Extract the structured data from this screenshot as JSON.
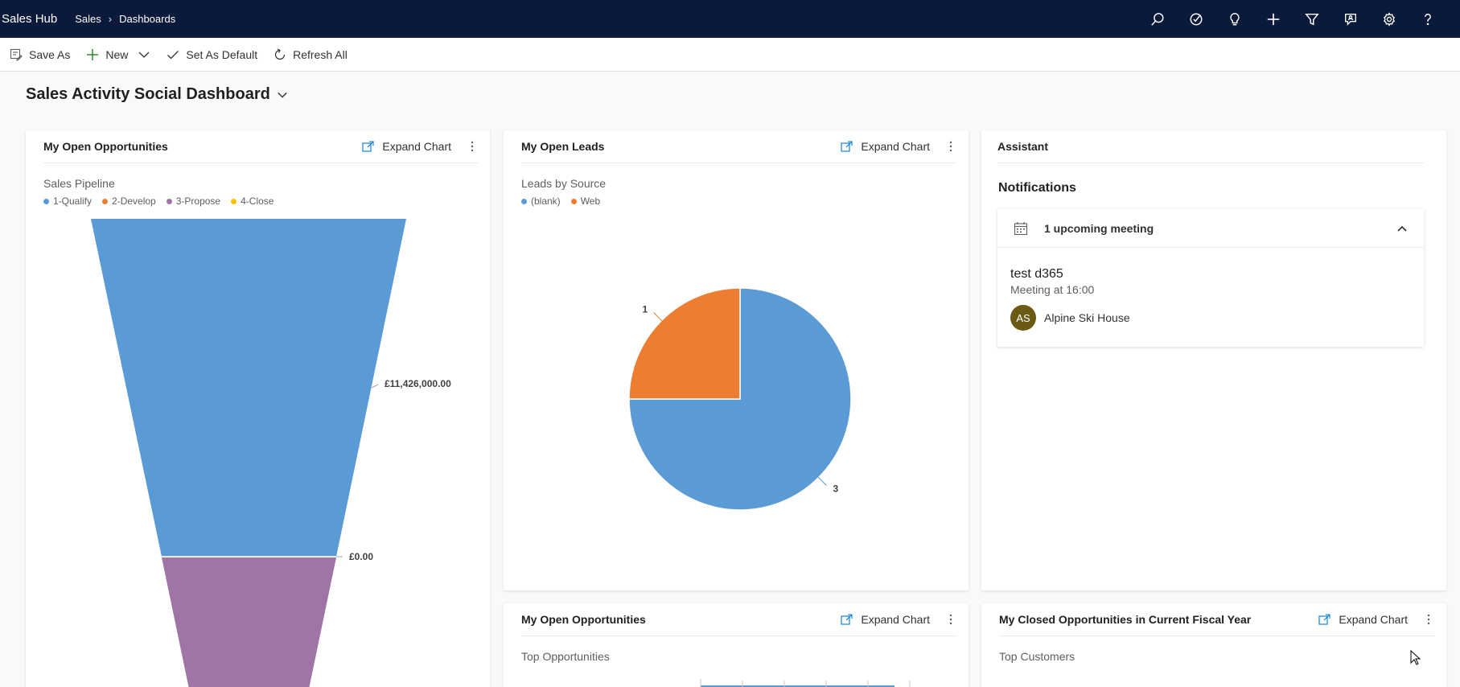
{
  "nav": {
    "app_name": "Sales Hub",
    "breadcrumb": [
      "Sales",
      "Dashboards"
    ],
    "icons": [
      "search-icon",
      "task-check-icon",
      "lightbulb-icon",
      "plus-icon",
      "filter-icon",
      "assistant-icon",
      "settings-icon",
      "help-icon"
    ]
  },
  "commands": {
    "save_as": "Save As",
    "new": "New",
    "set_default": "Set As Default",
    "refresh_all": "Refresh All"
  },
  "dashboard": {
    "title": "Sales Activity Social Dashboard"
  },
  "expand_label": "Expand Chart",
  "cards": {
    "opps": {
      "title": "My Open Opportunities",
      "chart_title": "Sales Pipeline",
      "legend": [
        {
          "label": "1-Qualify",
          "color": "#5b9bd5"
        },
        {
          "label": "2-Develop",
          "color": "#ed7d31"
        },
        {
          "label": "3-Propose",
          "color": "#a074a6"
        },
        {
          "label": "4-Close",
          "color": "#ffc000"
        }
      ]
    },
    "leads": {
      "title": "My Open Leads",
      "chart_title": "Leads by Source",
      "legend": [
        {
          "label": "(blank)",
          "color": "#5b9bd5"
        },
        {
          "label": "Web",
          "color": "#ed7d31"
        }
      ]
    },
    "assistant": {
      "title": "Assistant",
      "notifications_title": "Notifications",
      "group_label": "1 upcoming meeting",
      "meeting_title": "test d365",
      "meeting_time": "Meeting at 16:00",
      "avatar_initials": "AS",
      "account_name": "Alpine Ski House"
    },
    "opps2": {
      "title": "My Open Opportunities",
      "chart_title": "Top Opportunities"
    },
    "closed": {
      "title": "My Closed Opportunities in Current Fiscal Year",
      "chart_title": "Top Customers"
    }
  },
  "chart_data": [
    {
      "type": "funnel",
      "title": "Sales Pipeline",
      "categories": [
        "1-Qualify",
        "2-Develop",
        "3-Propose",
        "4-Close"
      ],
      "values": [
        11426000,
        0,
        null,
        null
      ],
      "value_labels": [
        "£11,426,000.00",
        "£0.00"
      ],
      "colors": [
        "#5b9bd5",
        "#ed7d31",
        "#a074a6",
        "#ffc000"
      ]
    },
    {
      "type": "pie",
      "title": "Leads by Source",
      "categories": [
        "(blank)",
        "Web"
      ],
      "values": [
        3,
        1
      ],
      "value_labels": [
        "3",
        "1"
      ],
      "colors": [
        "#5b9bd5",
        "#ed7d31"
      ]
    }
  ]
}
